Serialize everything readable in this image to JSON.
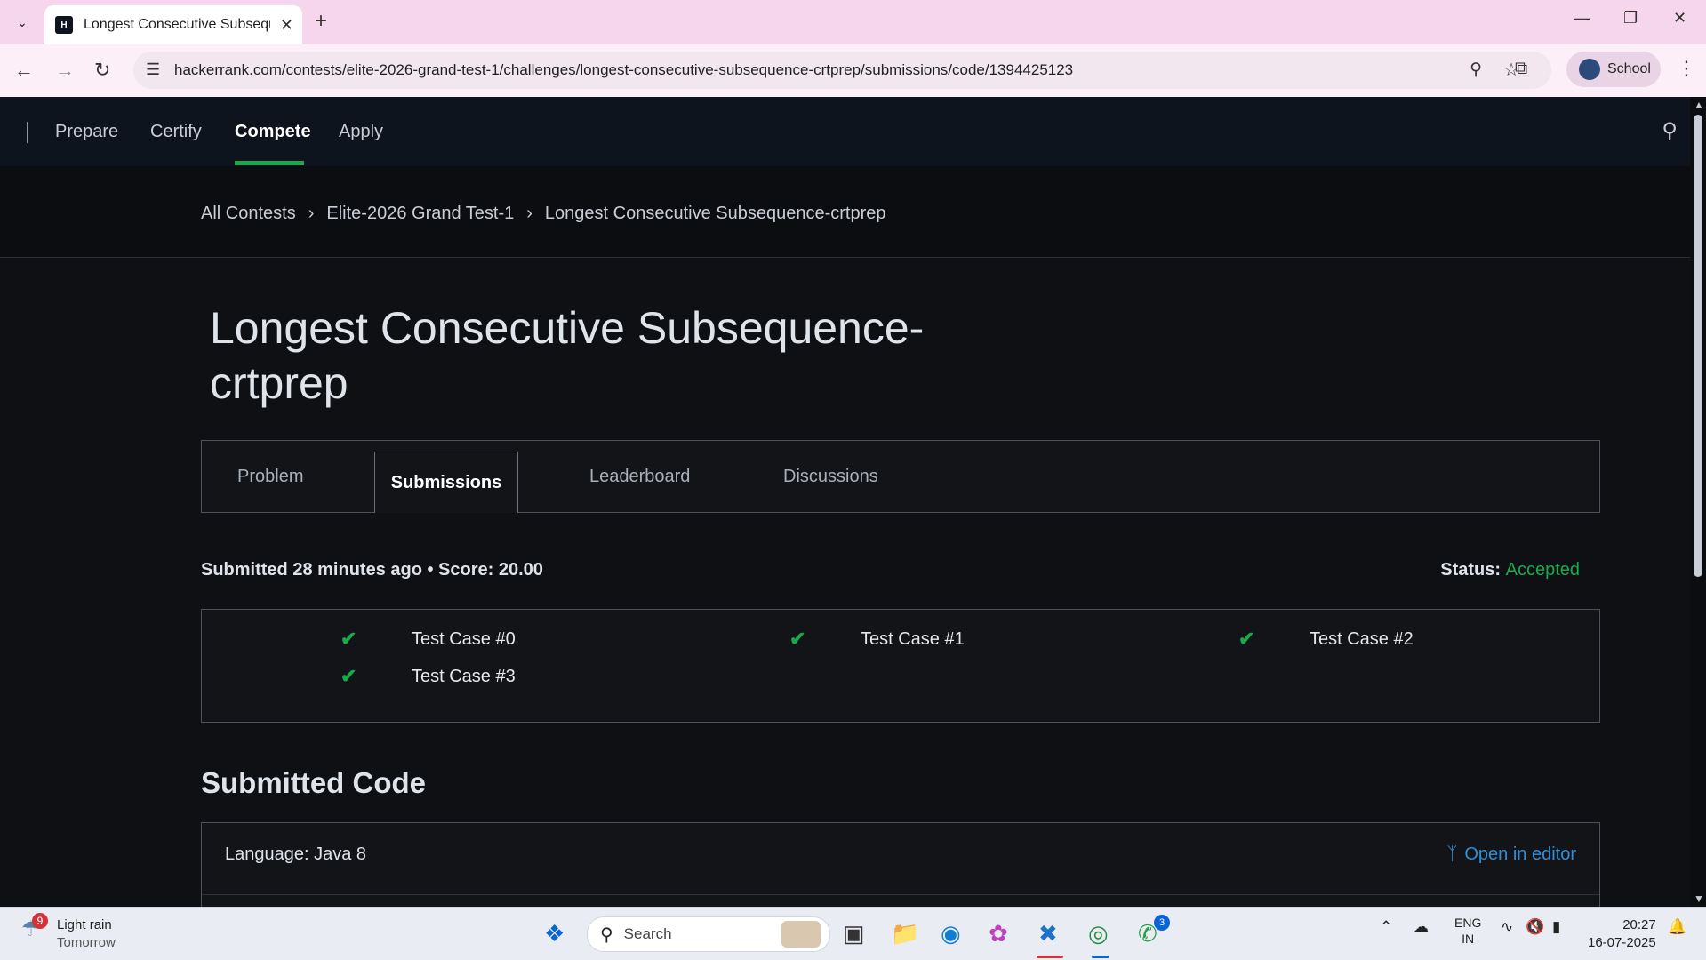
{
  "browser": {
    "tab_title": "Longest Consecutive Subsequence-crtprep",
    "favicon_text": "H",
    "url": "hackerrank.com/contests/elite-2026-grand-test-1/challenges/longest-consecutive-subsequence-crtprep/submissions/code/1394425123",
    "profile_label": "School"
  },
  "nav": {
    "items": [
      "Prepare",
      "Certify",
      "Compete",
      "Apply"
    ],
    "active": "Compete"
  },
  "breadcrumb": [
    "All Contests",
    "Elite-2026 Grand Test-1",
    "Longest Consecutive Subsequence-crtprep"
  ],
  "page": {
    "title": "Longest Consecutive Subsequence-crtprep",
    "tabs": [
      "Problem",
      "Submissions",
      "Leaderboard",
      "Discussions"
    ],
    "active_tab": "Submissions",
    "submitted_text": "Submitted 28 minutes ago • Score: 20.00",
    "status_label": "Status:",
    "status_value": "Accepted",
    "test_cases": [
      "Test Case #0",
      "Test Case #1",
      "Test Case #2",
      "Test Case #3"
    ],
    "submitted_code_heading": "Submitted Code",
    "language_text": "Language: Java 8",
    "open_in_editor": "Open in editor"
  },
  "colors": {
    "accent_green": "#1ba94c",
    "link_blue": "#2f8fd8",
    "nav_bg": "#0e141e"
  },
  "taskbar": {
    "weather_badge": "9",
    "weather_main": "Light rain",
    "weather_sub": "Tomorrow",
    "search_label": "Search",
    "whatsapp_badge": "3",
    "lang_line1": "ENG",
    "lang_line2": "IN",
    "time": "20:27",
    "date": "16-07-2025"
  }
}
